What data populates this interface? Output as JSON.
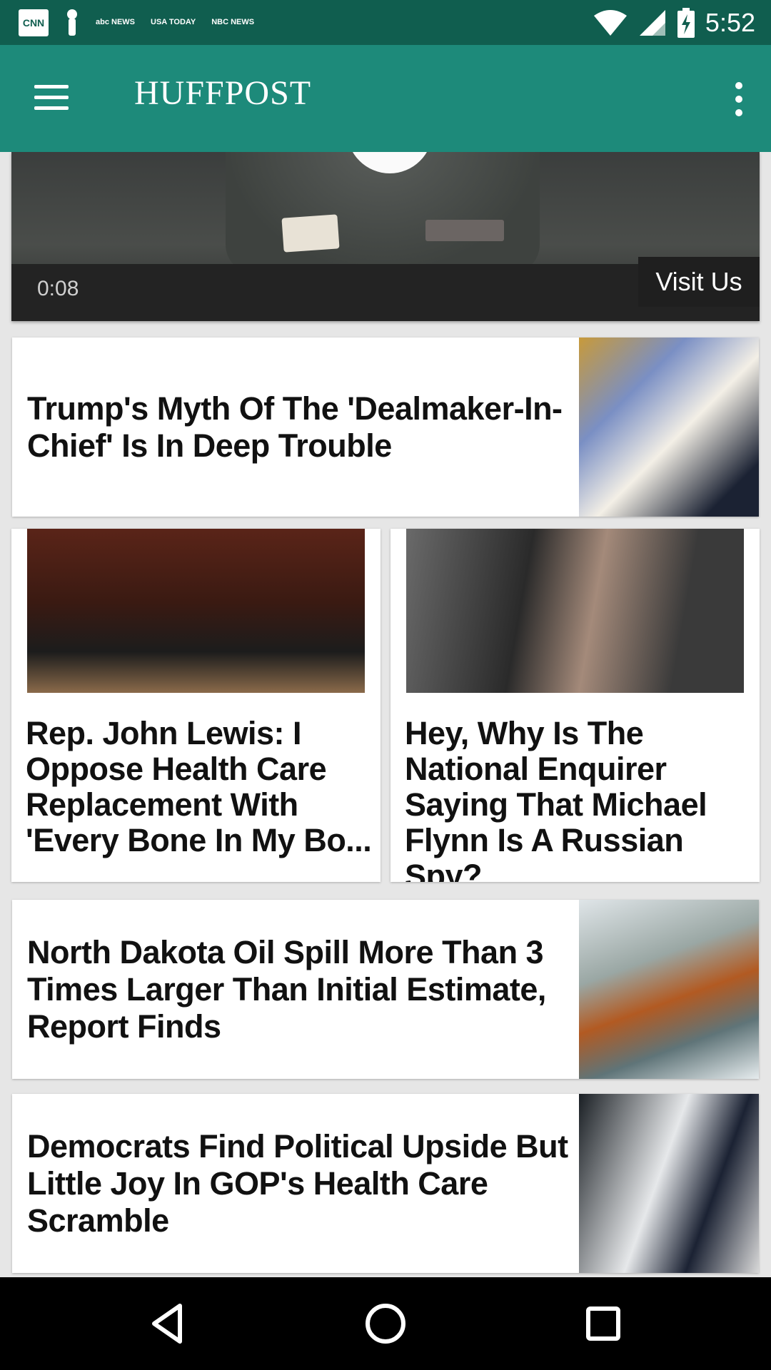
{
  "status_bar": {
    "notifications": [
      "CNN",
      "abc NEWS",
      "USA TODAY",
      "NBC NEWS"
    ],
    "time": "5:52"
  },
  "app_bar": {
    "logo": "HUFFPOST"
  },
  "video": {
    "time": "0:08",
    "cta": "Visit Us"
  },
  "articles": [
    {
      "headline": "Trump's Myth Of The 'Dealmaker-In-Chief' Is In Deep Trouble"
    },
    {
      "headline": "Rep. John Lewis: I Oppose Health Care Replacement With 'Every Bone In My Bo..."
    },
    {
      "headline": "Hey, Why Is The National Enquirer Saying That Michael Flynn Is A Russian Spy?"
    },
    {
      "headline": "North Dakota Oil Spill More Than 3 Times Larger Than Initial Estimate, Report Finds"
    },
    {
      "headline": "Democrats Find Political Upside But Little Joy In GOP's Health Care Scramble"
    }
  ]
}
